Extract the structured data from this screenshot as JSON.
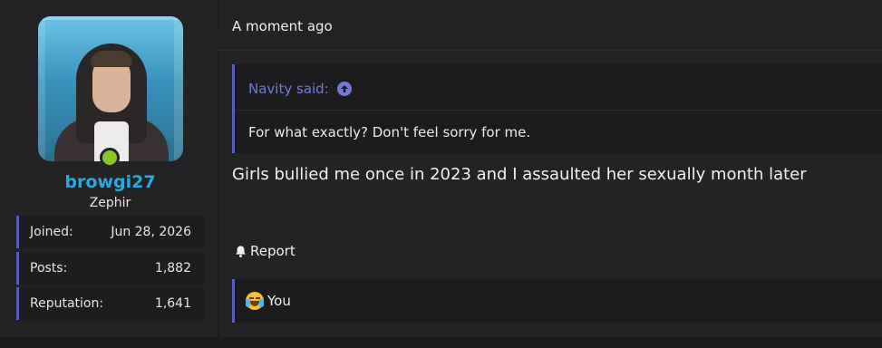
{
  "user": {
    "username": "browgi27",
    "title": "Zephir",
    "online": true,
    "stats": [
      {
        "label": "Joined:",
        "value": "Jun 28, 2026"
      },
      {
        "label": "Posts:",
        "value": "1,882"
      },
      {
        "label": "Reputation:",
        "value": "1,641"
      }
    ]
  },
  "post": {
    "date": "A moment ago",
    "quote": {
      "author_said": "Navity said:",
      "text": "For what exactly? Don't feel sorry for me."
    },
    "message": "Girls bullied me once in 2023 and I assaulted her sexually month later",
    "report_label": "Report",
    "reactions": {
      "emoji": "crying-laughing-emoji",
      "label": "You"
    }
  },
  "colors": {
    "accent": "#5a5fbf",
    "username": "#2aa8e0",
    "online": "#8bc52a",
    "quote_author": "#7479d6"
  }
}
